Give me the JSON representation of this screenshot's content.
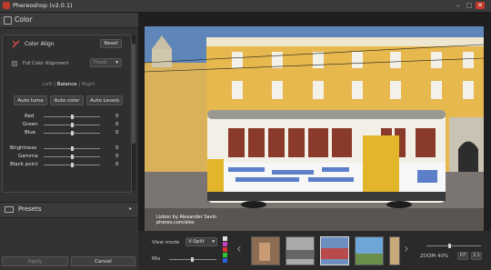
{
  "window": {
    "title": "Phereoshop (v2.0.1)",
    "minimize": "‒",
    "maximize": "□",
    "close": "✕"
  },
  "left_panel": {
    "header_label": "Color",
    "color_align": {
      "label": "Color Align",
      "reset": "Reset"
    },
    "full_alignment": {
      "label": "Full Color Alignment",
      "mode_value": "Fixed"
    },
    "balance": {
      "left": "Left",
      "center": "Balance",
      "right": "Right",
      "sep": "|"
    },
    "buttons": {
      "auto_luma": "Auto luma",
      "auto_color": "Auto color",
      "auto_levels": "Auto Levels"
    },
    "sliders_rgb": [
      {
        "label": "Red",
        "value": "0"
      },
      {
        "label": "Green",
        "value": "0"
      },
      {
        "label": "Blue",
        "value": "0"
      }
    ],
    "sliders_tone": [
      {
        "label": "Brightness",
        "value": "0"
      },
      {
        "label": "Gamma",
        "value": "0"
      },
      {
        "label": "Black point",
        "value": "0"
      }
    ],
    "presets_label": "Presets",
    "apply": "Apply",
    "cancel": "Cancel"
  },
  "photo": {
    "caption_line1": "Lisbon by Alexander Savin",
    "caption_line2": "phereo.com/alex"
  },
  "bottom_bar": {
    "view_mode_label": "View mode",
    "view_mode_value": "V-Split",
    "mix_label": "Mix",
    "zoom_label": "ZOOM",
    "zoom_value": "40%",
    "fit_button": "FIT",
    "one_to_one_button": "1:1",
    "swatch_colors": [
      "#e0e0e0",
      "#c040c0",
      "#e03030",
      "#30c030",
      "#3060e0"
    ]
  }
}
